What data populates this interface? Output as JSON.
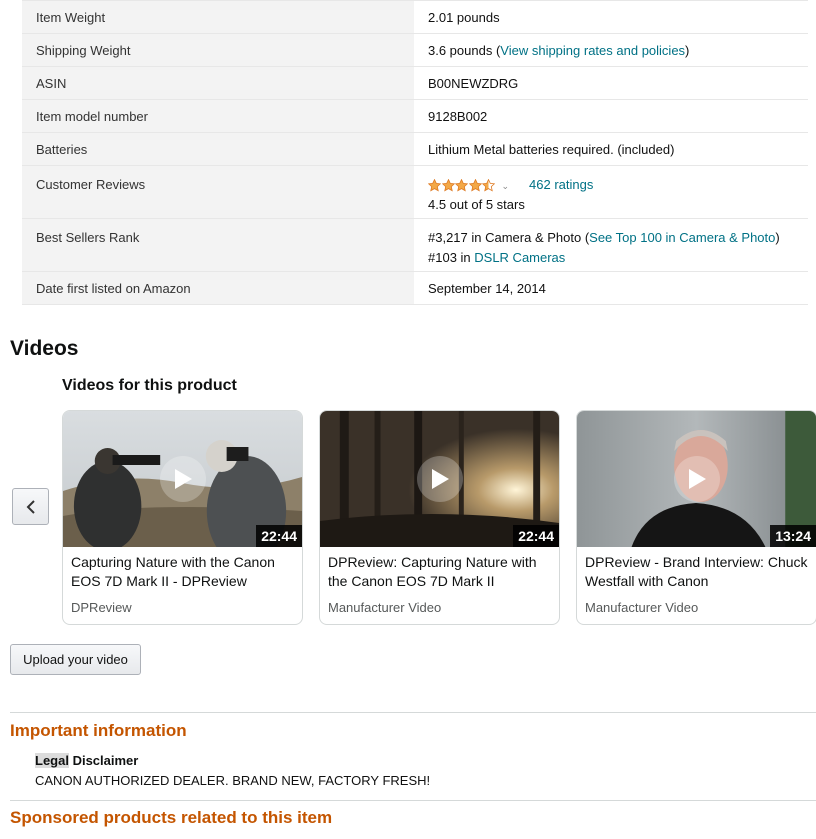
{
  "details": {
    "item_weight": {
      "label": "Item Weight",
      "value": "2.01 pounds"
    },
    "shipping_weight": {
      "label": "Shipping Weight",
      "value_prefix": "3.6 pounds (",
      "link": "View shipping rates and policies",
      "value_suffix": ")"
    },
    "asin": {
      "label": "ASIN",
      "value": "B00NEWZDRG"
    },
    "model_number": {
      "label": "Item model number",
      "value": "9128B002"
    },
    "batteries": {
      "label": "Batteries",
      "value": "Lithium Metal batteries required. (included)"
    },
    "customer_reviews": {
      "label": "Customer Reviews",
      "rating": 4.5,
      "ratings_link": "462 ratings",
      "summary": "4.5 out of 5 stars"
    },
    "best_sellers_rank": {
      "label": "Best Sellers Rank",
      "line1_prefix": "#3,217 in Camera & Photo (",
      "line1_link": "See Top 100 in Camera & Photo",
      "line1_suffix": ")",
      "line2_prefix": "#103 in ",
      "line2_link": "DSLR Cameras"
    },
    "date_first_listed": {
      "label": "Date first listed on Amazon",
      "value": "September 14, 2014"
    }
  },
  "videos": {
    "heading": "Videos",
    "subheading": "Videos for this product",
    "items": [
      {
        "title": "Capturing Nature with the Canon EOS 7D Mark II - DPReview",
        "duration": "22:44",
        "source": "DPReview"
      },
      {
        "title": "DPReview: Capturing Nature with the Canon EOS 7D Mark II",
        "duration": "22:44",
        "source": "Manufacturer Video"
      },
      {
        "title": "DPReview - Brand Interview: Chuck Westfall with Canon",
        "duration": "13:24",
        "source": "Manufacturer Video"
      }
    ],
    "upload_label": "Upload your video"
  },
  "important": {
    "heading": "Important information",
    "legal_highlight": "Legal",
    "legal_rest": " Disclaimer",
    "disclaimer_text": "CANON AUTHORIZED DEALER. BRAND NEW, FACTORY FRESH!"
  },
  "sponsored": {
    "heading": "Sponsored products related to this item"
  },
  "colors": {
    "link": "#007185",
    "section_heading": "#c45500",
    "star": "#f3a847",
    "label_bg": "#f3f3f3"
  }
}
